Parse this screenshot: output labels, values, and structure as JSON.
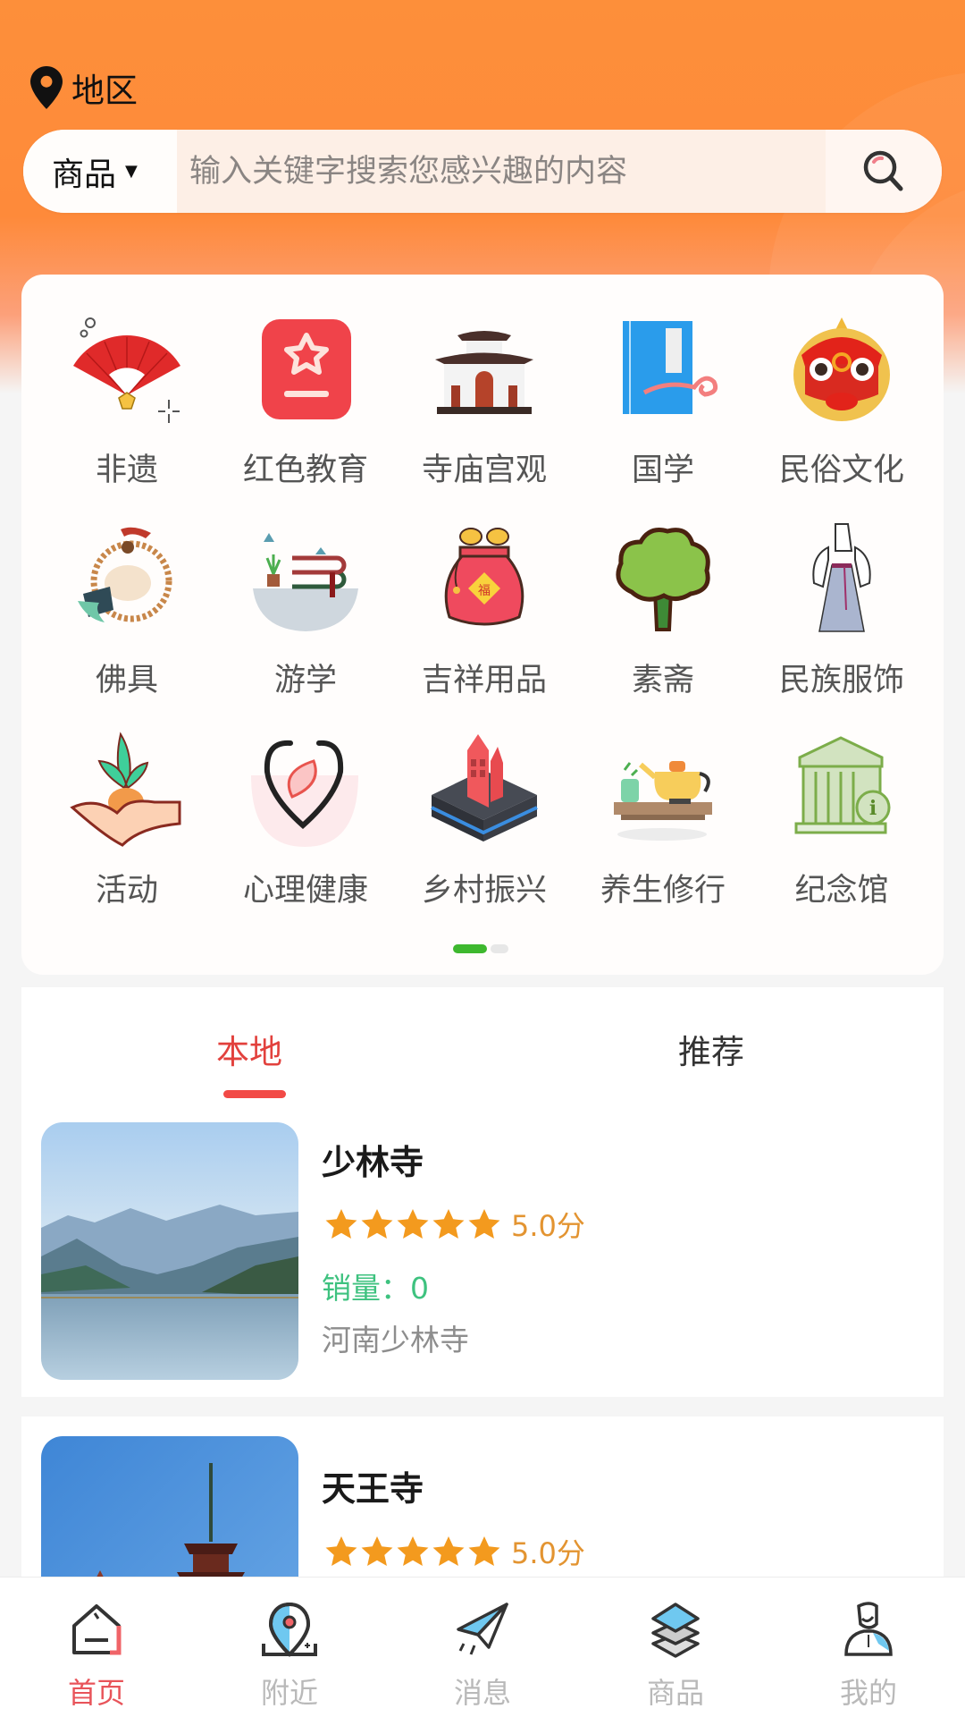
{
  "header": {
    "location_icon": "map-pin-icon",
    "location_label": "地区",
    "search": {
      "category_selected": "商品",
      "category_caret": "▼",
      "placeholder": "输入关键字搜索您感兴趣的内容",
      "value": "",
      "button_icon": "search-icon"
    }
  },
  "categories": {
    "items": [
      {
        "label": "非遗",
        "icon": "folding-fan-icon"
      },
      {
        "label": "红色教育",
        "icon": "red-star-book-icon"
      },
      {
        "label": "寺庙宫观",
        "icon": "temple-icon"
      },
      {
        "label": "国学",
        "icon": "classic-book-icon"
      },
      {
        "label": "民俗文化",
        "icon": "lion-dance-icon"
      },
      {
        "label": "佛具",
        "icon": "prayer-beads-icon"
      },
      {
        "label": "游学",
        "icon": "study-tour-icon"
      },
      {
        "label": "吉祥用品",
        "icon": "lucky-bag-icon"
      },
      {
        "label": "素斋",
        "icon": "broccoli-icon"
      },
      {
        "label": "民族服饰",
        "icon": "hanfu-dress-icon"
      },
      {
        "label": "活动",
        "icon": "sprout-in-hand-icon"
      },
      {
        "label": "心理健康",
        "icon": "heart-leaf-icon"
      },
      {
        "label": "乡村振兴",
        "icon": "village-house-icon"
      },
      {
        "label": "养生修行",
        "icon": "teapot-icon"
      },
      {
        "label": "纪念馆",
        "icon": "memorial-hall-icon"
      }
    ],
    "pager": {
      "pages": 2,
      "current": 1
    }
  },
  "tabs": [
    {
      "label": "本地",
      "active": true
    },
    {
      "label": "推荐",
      "active": false
    }
  ],
  "listings": [
    {
      "name": "少林寺",
      "stars": 5,
      "score": "5.0分",
      "sales": "销量：0",
      "address": "河南少林寺",
      "image": "lake-mountains-photo"
    },
    {
      "name": "天王寺",
      "stars": 5,
      "score": "5.0分",
      "image": "pagoda-photo"
    }
  ],
  "bottom_nav": [
    {
      "label": "首页",
      "icon": "home-icon",
      "active": true
    },
    {
      "label": "附近",
      "icon": "location-pin-icon",
      "active": false
    },
    {
      "label": "消息",
      "icon": "paper-plane-icon",
      "active": false
    },
    {
      "label": "商品",
      "icon": "layers-icon",
      "active": false
    },
    {
      "label": "我的",
      "icon": "user-icon",
      "active": false
    }
  ],
  "colors": {
    "header_orange": "#fd8f3a",
    "tab_active": "#e2413d",
    "star": "#f39a1e",
    "score": "#e39431",
    "sales": "#3ec27f",
    "pager_active": "#3eb82f",
    "nav_active": "#e8545a",
    "nav_inactive": "#b9b9b9"
  }
}
